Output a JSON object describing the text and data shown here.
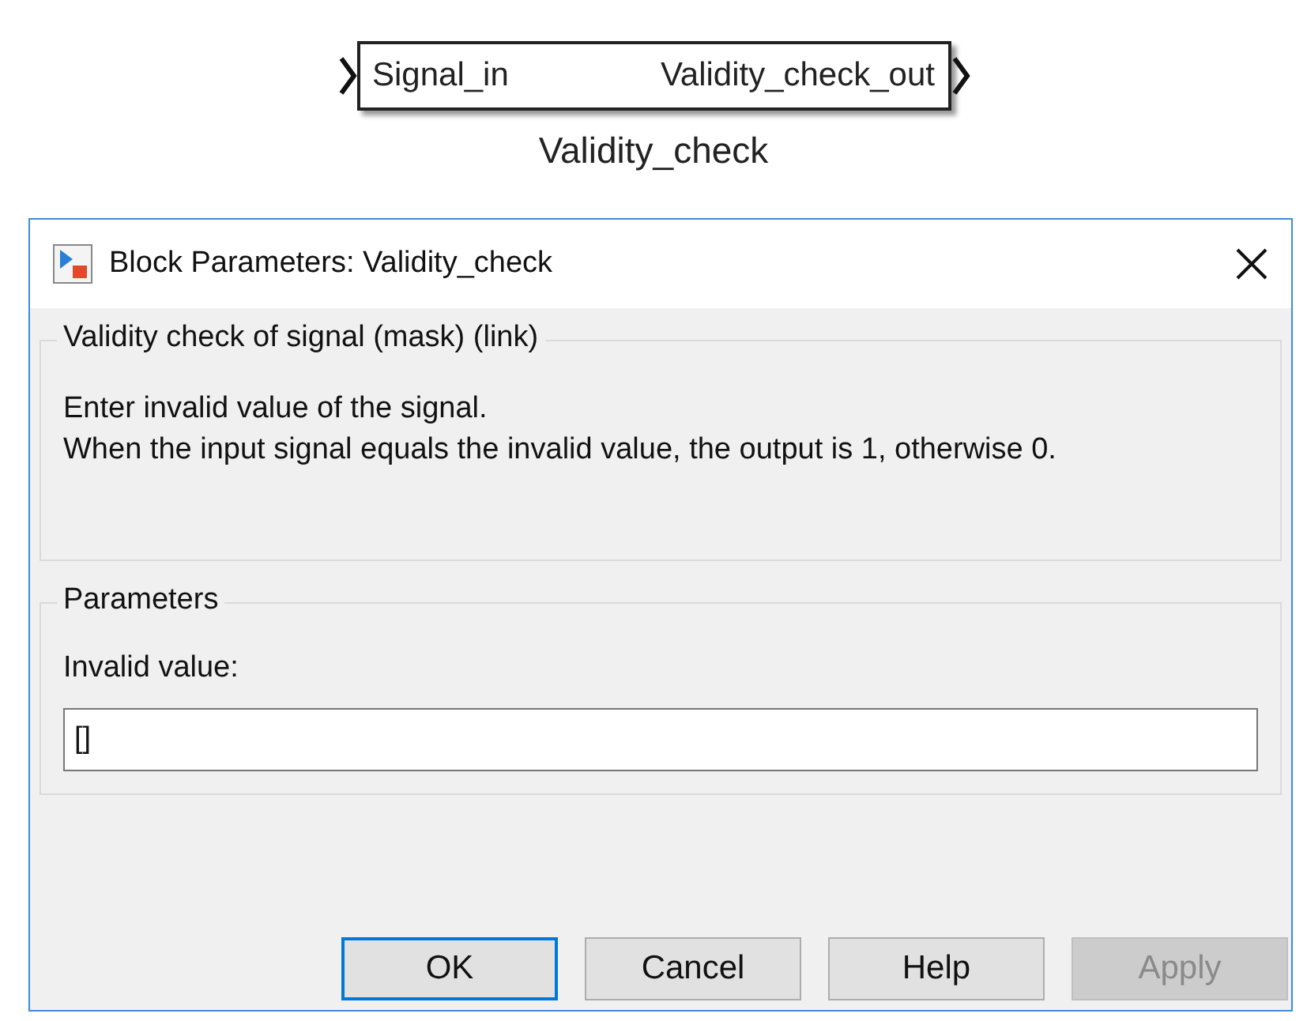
{
  "block": {
    "input_port": "Signal_in",
    "output_port": "Validity_check_out",
    "name": "Validity_check"
  },
  "dialog": {
    "title": "Block Parameters: Validity_check",
    "description_group": {
      "title": "Validity check of signal (mask) (link)",
      "lines": [
        "Enter invalid value of the signal.",
        "When the input signal equals the invalid value, the output is 1, otherwise 0."
      ]
    },
    "parameters_group": {
      "title": "Parameters",
      "field_label": "Invalid value:",
      "field_value": "[]"
    },
    "buttons": [
      {
        "label": "OK",
        "default": true,
        "disabled": false
      },
      {
        "label": "Cancel",
        "default": false,
        "disabled": false
      },
      {
        "label": "Help",
        "default": false,
        "disabled": false
      },
      {
        "label": "Apply",
        "default": false,
        "disabled": true
      }
    ]
  }
}
